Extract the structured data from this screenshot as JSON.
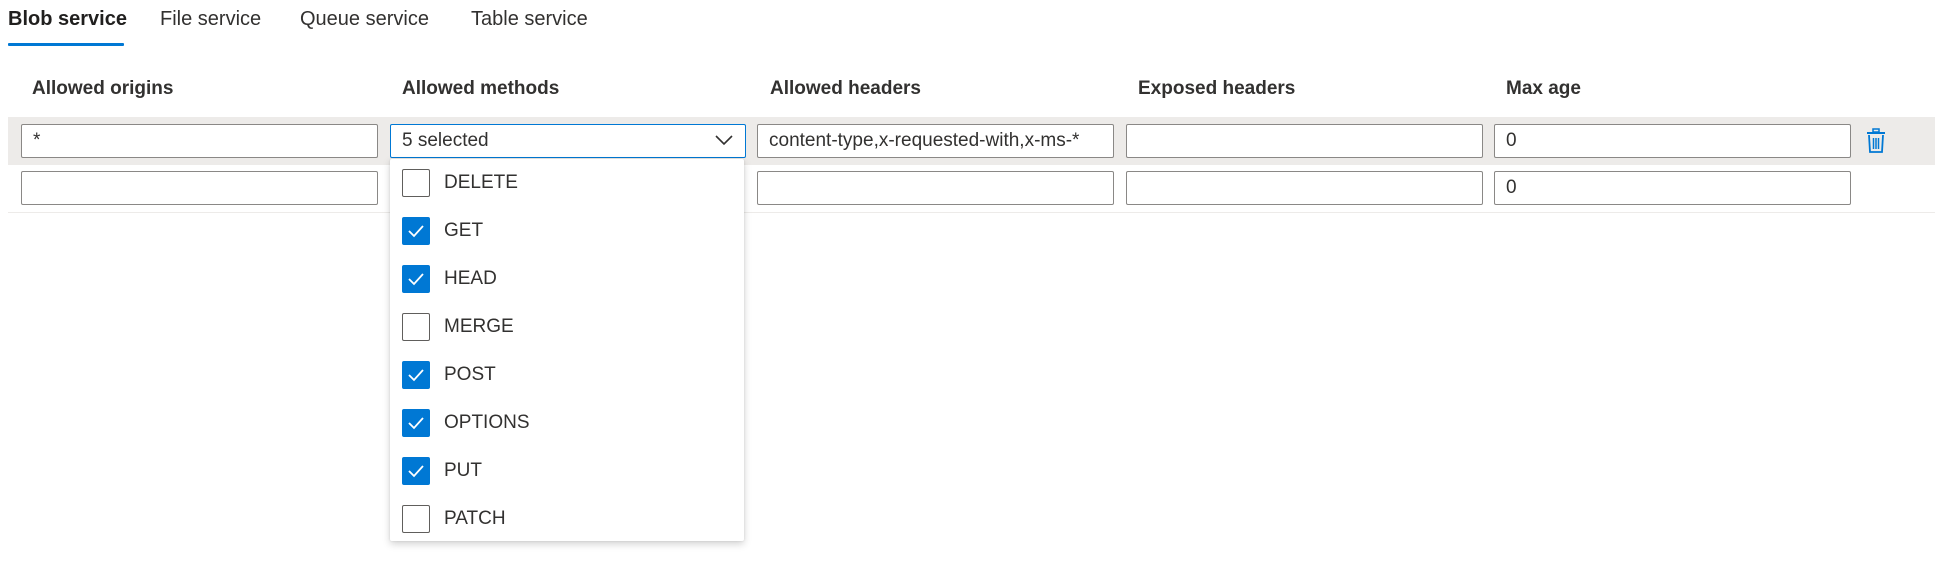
{
  "tabs": [
    {
      "label": "Blob service",
      "active": true
    },
    {
      "label": "File service",
      "active": false
    },
    {
      "label": "Queue service",
      "active": false
    },
    {
      "label": "Table service",
      "active": false
    }
  ],
  "columns": {
    "allowed_origins": "Allowed origins",
    "allowed_methods": "Allowed methods",
    "allowed_headers": "Allowed headers",
    "exposed_headers": "Exposed headers",
    "max_age": "Max age"
  },
  "rows": [
    {
      "allowed_origins": "*",
      "allowed_methods": "5 selected",
      "allowed_headers": "content-type,x-requested-with,x-ms-*",
      "exposed_headers": "",
      "max_age": "0"
    },
    {
      "allowed_origins": "",
      "allowed_methods": "",
      "allowed_headers": "",
      "exposed_headers": "",
      "max_age": "0"
    }
  ],
  "methods_options": [
    {
      "label": "DELETE",
      "checked": false
    },
    {
      "label": "GET",
      "checked": true
    },
    {
      "label": "HEAD",
      "checked": true
    },
    {
      "label": "MERGE",
      "checked": false
    },
    {
      "label": "POST",
      "checked": true
    },
    {
      "label": "OPTIONS",
      "checked": true
    },
    {
      "label": "PUT",
      "checked": true
    },
    {
      "label": "PATCH",
      "checked": false
    }
  ],
  "icons": {
    "delete_row": "trash-icon",
    "dropdown": "chevron-down-icon",
    "check": "checkmark-icon"
  },
  "colors": {
    "accent": "#0078d4",
    "selected_row": "#edebe9"
  }
}
